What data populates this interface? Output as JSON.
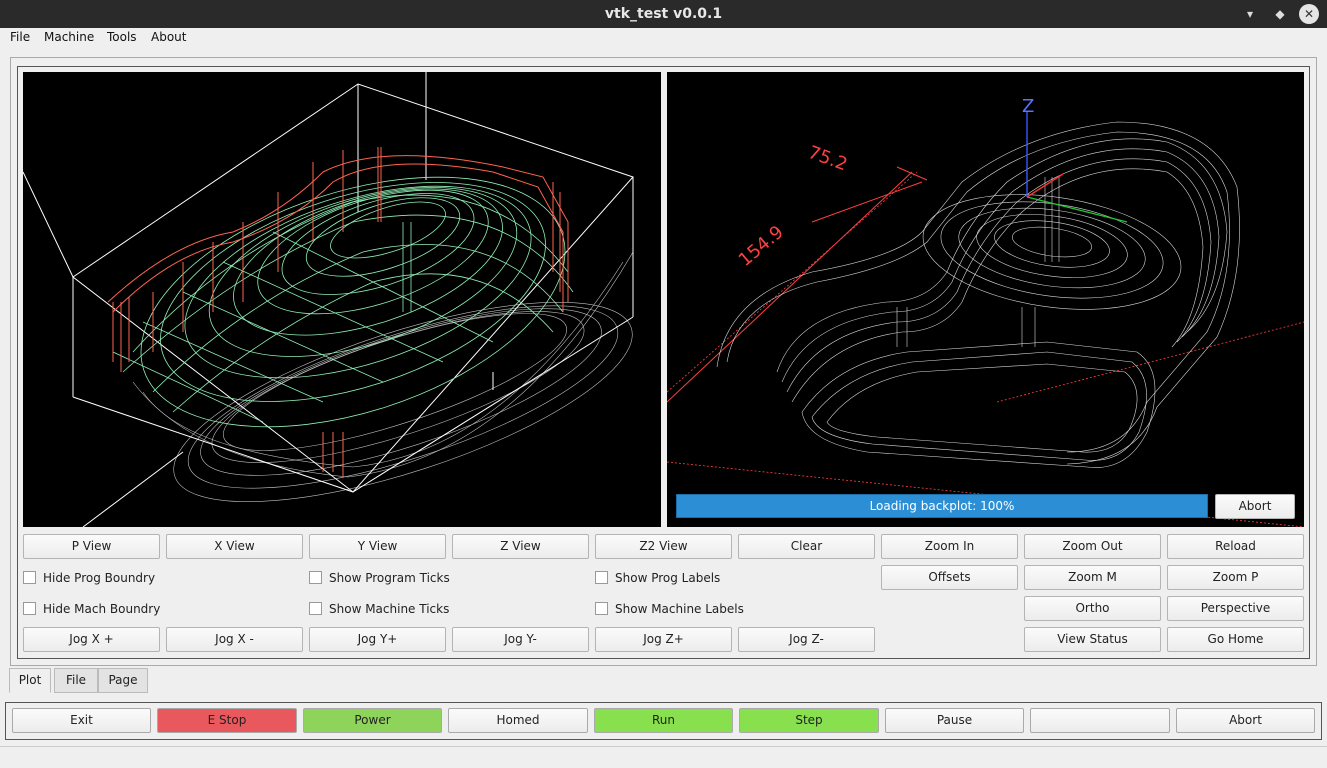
{
  "window": {
    "title": "vtk_test v0.0.1"
  },
  "menu": [
    "File",
    "Machine",
    "Tools",
    "About"
  ],
  "viewport_right": {
    "axis_label": "Z",
    "dim_x": "75.2",
    "dim_y": "154.9",
    "progress_text": "Loading backplot: 100%",
    "abort_label": "Abort"
  },
  "view_buttons": [
    "P View",
    "X View",
    "Y View",
    "Z View",
    "Z2 View",
    "Clear",
    "Zoom In",
    "Zoom Out",
    "Reload"
  ],
  "row2_buttons": [
    "Offsets",
    "Zoom M",
    "Zoom P"
  ],
  "row3_buttons": [
    "Ortho",
    "Perspective"
  ],
  "jog_buttons": [
    "Jog X +",
    "Jog X -",
    "Jog Y+",
    "Jog Y-",
    "Jog Z+",
    "Jog Z-"
  ],
  "row4_buttons": [
    "View Status",
    "Go Home"
  ],
  "checkboxes": {
    "hide_prog_boundry": "Hide Prog Boundry",
    "show_program_ticks": "Show Program Ticks",
    "show_prog_labels": "Show Prog Labels",
    "hide_mach_boundry": "Hide Mach Boundry",
    "show_machine_ticks": "Show Machine Ticks",
    "show_machine_labels": "Show Machine Labels"
  },
  "tabs": [
    "Plot",
    "File",
    "Page"
  ],
  "control_buttons": [
    {
      "label": "Exit",
      "color": "#f0f0f0"
    },
    {
      "label": "E Stop",
      "color": "#e8585c"
    },
    {
      "label": "Power",
      "color": "#8fd45a"
    },
    {
      "label": "Homed",
      "color": "#f0f0f0"
    },
    {
      "label": "Run",
      "color": "#88e04e"
    },
    {
      "label": "Step",
      "color": "#88e04e"
    },
    {
      "label": "Pause",
      "color": "#f0f0f0"
    },
    {
      "label": "",
      "color": "#f0f0f0"
    },
    {
      "label": "Abort",
      "color": "#f0f0f0"
    }
  ]
}
